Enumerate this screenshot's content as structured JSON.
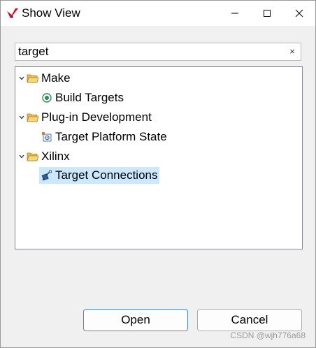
{
  "window": {
    "title": "Show View"
  },
  "search": {
    "value": "target",
    "clear_glyph": "×"
  },
  "tree": {
    "groups": [
      {
        "label": "Make",
        "expanded": true,
        "icon": "open-folder-icon",
        "children": [
          {
            "label": "Build Targets",
            "icon": "build-targets-icon",
            "selected": false
          }
        ]
      },
      {
        "label": "Plug-in Development",
        "expanded": true,
        "icon": "open-folder-icon",
        "children": [
          {
            "label": "Target Platform State",
            "icon": "target-platform-icon",
            "selected": false
          }
        ]
      },
      {
        "label": "Xilinx",
        "expanded": true,
        "icon": "open-folder-icon",
        "children": [
          {
            "label": "Target Connections",
            "icon": "target-connections-icon",
            "selected": true
          }
        ]
      }
    ]
  },
  "buttons": {
    "open_label": "Open",
    "cancel_label": "Cancel"
  },
  "watermark": "CSDN @wjh776a68",
  "colors": {
    "selection": "#cce8ff",
    "default_button_border": "#4d87d6",
    "folder": "#e8b84a",
    "app_icon_red": "#c8102e"
  }
}
